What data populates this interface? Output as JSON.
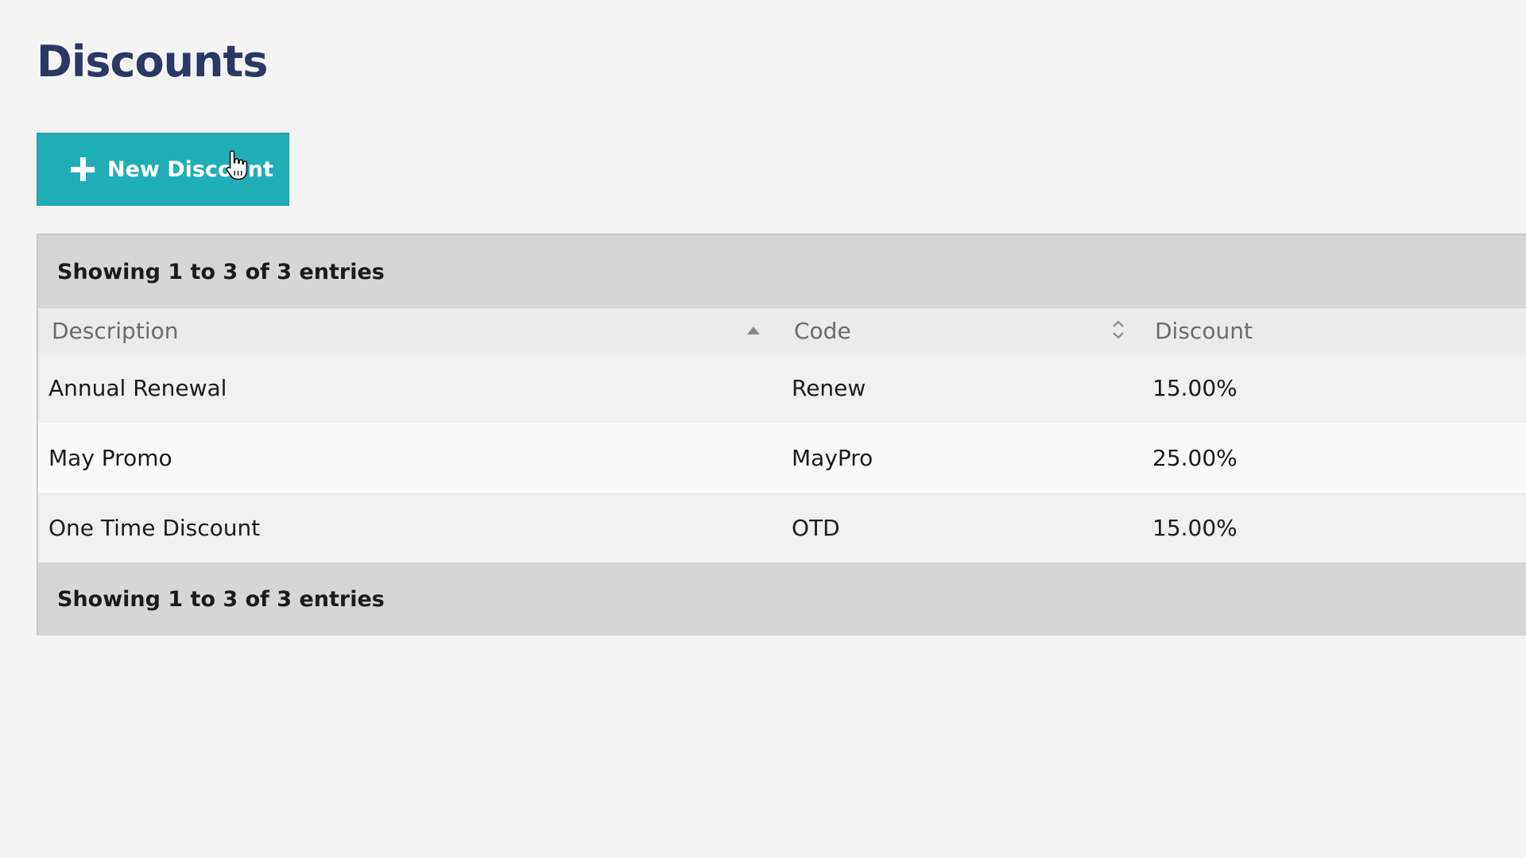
{
  "page": {
    "title": "Discounts"
  },
  "toolbar": {
    "new_label": "New Discount",
    "new_icon": "plus-icon"
  },
  "table": {
    "info_top": "Showing 1 to 3 of 3 entries",
    "info_bottom": "Showing 1 to 3 of 3 entries",
    "columns": [
      {
        "label": "Description",
        "sort": "ascending"
      },
      {
        "label": "Code",
        "sort": "sortable"
      },
      {
        "label": "Discount",
        "sort": "none"
      }
    ],
    "rows": [
      {
        "description": "Annual Renewal",
        "code": "Renew",
        "discount": "15.00%"
      },
      {
        "description": "May Promo",
        "code": "MayPro",
        "discount": "25.00%"
      },
      {
        "description": "One Time Discount",
        "code": "OTD",
        "discount": "15.00%"
      }
    ]
  },
  "colors": {
    "accent": "#20aeb6",
    "title": "#2b3863",
    "background": "#f4f4f4"
  }
}
